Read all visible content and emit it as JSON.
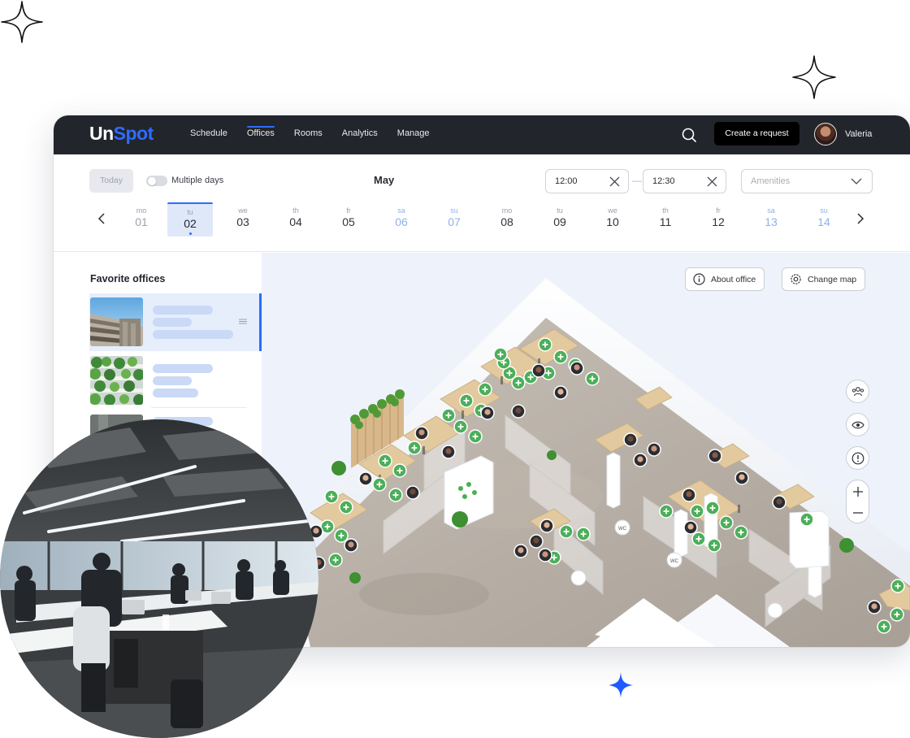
{
  "app": {
    "logo_part1": "Un",
    "logo_part2": "Spot",
    "nav": [
      "Schedule",
      "Offices",
      "Rooms",
      "Analytics",
      "Manage"
    ],
    "active_nav": "Offices",
    "request_button": "Create a request",
    "user_name": "Valeria"
  },
  "datebar": {
    "today_button": "Today",
    "multiple_days_label": "Multiple days",
    "multiple_days_on": false,
    "month": "May",
    "time_from": "12:00",
    "time_to": "12:30",
    "time_separator": "—",
    "amenities_placeholder": "Amenities",
    "days": [
      {
        "w": "mo",
        "d": "01",
        "state": "past"
      },
      {
        "w": "tu",
        "d": "02",
        "state": "selected"
      },
      {
        "w": "we",
        "d": "03",
        "state": "normal"
      },
      {
        "w": "th",
        "d": "04",
        "state": "normal"
      },
      {
        "w": "fr",
        "d": "05",
        "state": "normal"
      },
      {
        "w": "sa",
        "d": "06",
        "state": "weekend"
      },
      {
        "w": "su",
        "d": "07",
        "state": "weekend"
      },
      {
        "w": "mo",
        "d": "08",
        "state": "normal"
      },
      {
        "w": "tu",
        "d": "09",
        "state": "normal"
      },
      {
        "w": "we",
        "d": "10",
        "state": "normal"
      },
      {
        "w": "th",
        "d": "11",
        "state": "normal"
      },
      {
        "w": "fr",
        "d": "12",
        "state": "normal"
      },
      {
        "w": "sa",
        "d": "13",
        "state": "weekend"
      },
      {
        "w": "su",
        "d": "14",
        "state": "weekend"
      }
    ]
  },
  "sidebar": {
    "title": "Favorite offices"
  },
  "map": {
    "about_button": "About office",
    "change_map_button": "Change map",
    "wc_label": "WC"
  },
  "colors": {
    "accent": "#2d6cff",
    "topbar": "#22252b",
    "seat_available": "#4caf5a",
    "weekend": "#8fb1ea",
    "selected_day_bg": "#dfe8f9"
  }
}
